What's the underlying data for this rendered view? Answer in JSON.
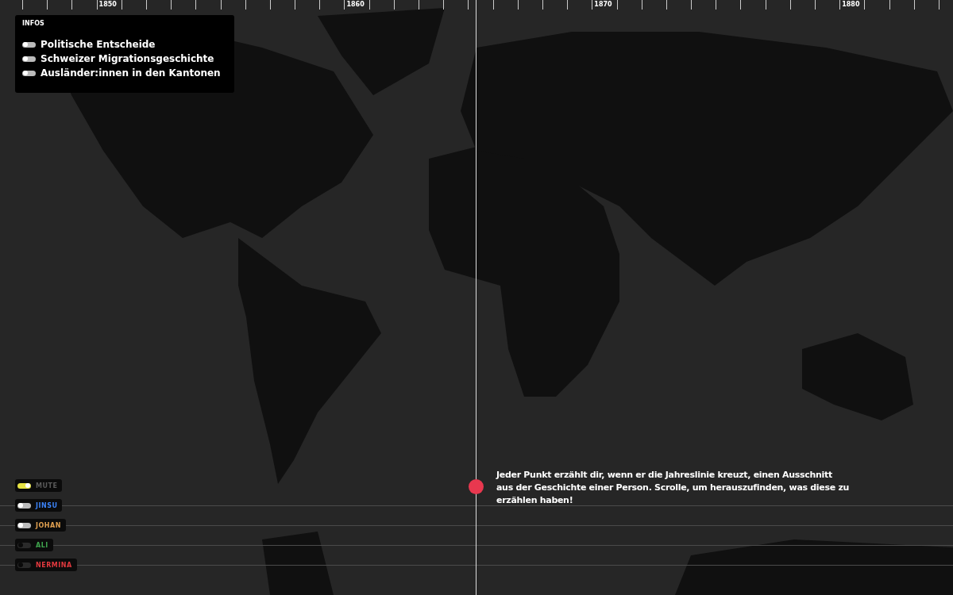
{
  "timeline": {
    "labels": [
      "1850",
      "1860",
      "1870",
      "1880"
    ]
  },
  "infos": {
    "title": "INFOS",
    "items": [
      {
        "label": "Politische Entscheide",
        "on": false
      },
      {
        "label": "Schweizer Migrationsgeschichte",
        "on": false
      },
      {
        "label": "Ausländer:innen in den Kantonen",
        "on": false
      }
    ]
  },
  "people": [
    {
      "label": "MUTE",
      "kind": "mute",
      "on": true,
      "disabled": false,
      "color": "#5a5a5a"
    },
    {
      "label": "JINSU",
      "kind": "person",
      "on": false,
      "disabled": false,
      "color": "#3b82f6"
    },
    {
      "label": "JOHAN",
      "kind": "person",
      "on": false,
      "disabled": false,
      "color": "#e0a050"
    },
    {
      "label": "ALI",
      "kind": "person",
      "on": false,
      "disabled": true,
      "color": "#3fa34d"
    },
    {
      "label": "NERMINA",
      "kind": "person",
      "on": false,
      "disabled": true,
      "color": "#e0393e"
    }
  ],
  "intro": "Jeder Punkt erzählt dir, wenn er die Jahreslinie kreuzt, einen Ausschnitt aus der Geschichte einer Person. Scrolle, um herauszufinden, was diese zu erzählen haben!"
}
